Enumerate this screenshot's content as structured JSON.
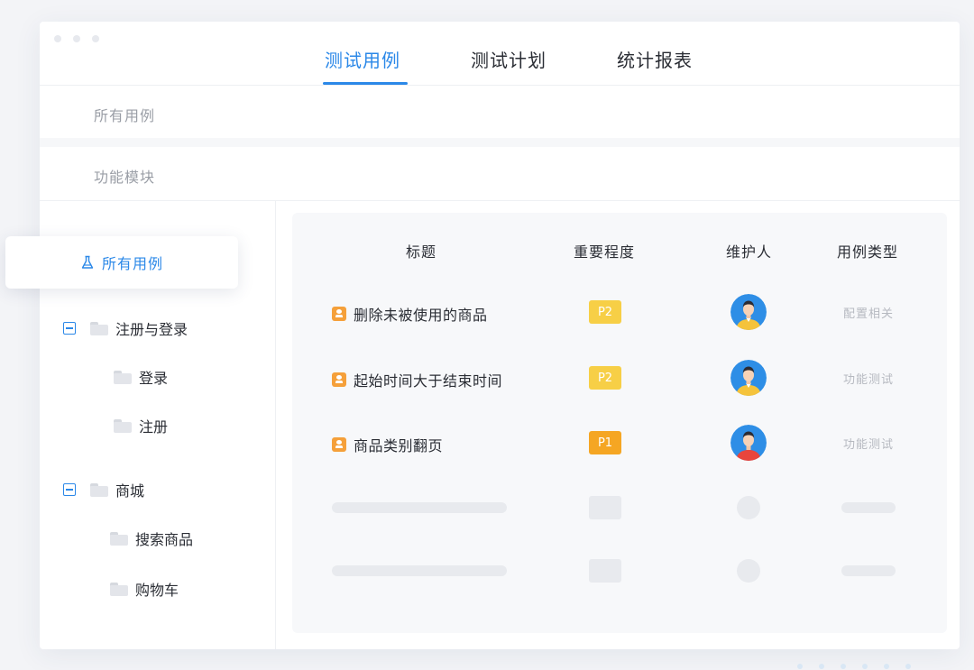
{
  "tabs": [
    {
      "label": "测试用例",
      "active": true
    },
    {
      "label": "测试计划",
      "active": false
    },
    {
      "label": "统计报表",
      "active": false
    }
  ],
  "filters": {
    "scope_label": "所有用例",
    "module_label": "功能模块"
  },
  "sidebar": {
    "all_cases_label": "所有用例",
    "tree": [
      {
        "label": "注册与登录",
        "children": [
          {
            "label": "登录"
          },
          {
            "label": "注册"
          }
        ]
      },
      {
        "label": "商城",
        "children": [
          {
            "label": "搜索商品"
          },
          {
            "label": "购物车"
          }
        ]
      }
    ]
  },
  "table": {
    "headers": {
      "title": "标题",
      "priority": "重要程度",
      "owner": "维护人",
      "type": "用例类型"
    },
    "rows": [
      {
        "title": "删除未被使用的商品",
        "priority": "P2",
        "type": "配置相关",
        "avatar_shirt": "#f5c33b"
      },
      {
        "title": "起始时间大于结束时间",
        "priority": "P2",
        "type": "功能测试",
        "avatar_shirt": "#f5c33b"
      },
      {
        "title": "商品类别翻页",
        "priority": "P1",
        "type": "功能测试",
        "avatar_shirt": "#e8453c"
      }
    ]
  },
  "colors": {
    "accent": "#2b88e8",
    "p2": "#f7cf46",
    "p1": "#f5a623",
    "case_icon": "#f5a03a",
    "avatar_bg": "#2e8ee6"
  }
}
